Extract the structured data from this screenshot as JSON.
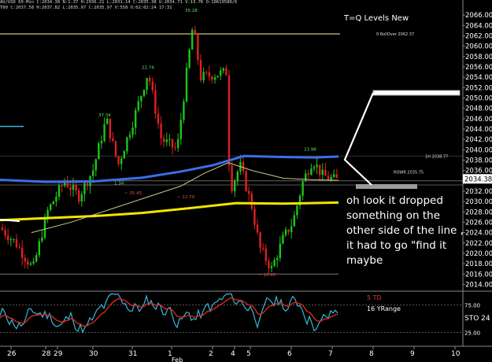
{
  "header": {
    "line1": "AU/USD 60-Min C:2034.38 N:1.37 H:2036.21 L:2031.14 C:2035.38 U:2034.71 V:13.7K O:10619580/6",
    "line2": "T00 C:2037.58 H:2037.82 L:2035.97 C:2035.97 V:558 O:02:02:24 17:31"
  },
  "panel_title": "T=Q Levels New",
  "annotation_note": "oh look it dropped something on the other side of the line , it had to go \"find it maybe",
  "colors": {
    "background": "#000000",
    "candle_up": "#19c719",
    "candle_down": "#e02020",
    "ma_blue": "#3b6fe8",
    "ma_yellow": "#f2e500",
    "ma_thin": "#c9c98a",
    "osc_cyan": "#35b8d6",
    "osc_red": "#d8281c",
    "rollover": "#e8d890"
  },
  "chart_data": {
    "type": "candlestick",
    "title": "T=Q Levels New",
    "y_range": [
      2013,
      2068
    ],
    "y_ticks": [
      "2066.00",
      "2064.00",
      "2062.00",
      "2060.00",
      "2058.00",
      "2056.00",
      "2054.00",
      "2052.00",
      "2050.00",
      "2048.00",
      "2046.00",
      "2044.00",
      "2042.00",
      "2040.00",
      "2038.00",
      "2036.00",
      "2034.00",
      "2032.00",
      "2030.00",
      "2028.00",
      "2026.00",
      "2024.00",
      "2022.00",
      "2020.00",
      "2018.00",
      "2016.00",
      "2014.00"
    ],
    "last_price": "2034.38",
    "x_labels": [
      "26",
      "28",
      "29",
      "30",
      "31",
      "1",
      "2",
      "4",
      "5",
      "6",
      "7",
      "8",
      "9",
      "10"
    ],
    "month_label": "Feb",
    "levels": [
      {
        "label": "0 RollOver 2062.37",
        "value": 2062.37
      },
      {
        "label": "1H 2038.77",
        "value": 2038.77
      },
      {
        "label": "ROWR 2035.75",
        "value": 2035.75
      }
    ],
    "peak_labels": [
      {
        "text": "35.28",
        "value": 2066.6
      },
      {
        "text": "22.74",
        "value": 2055.6
      },
      {
        "text": "37.34",
        "value": 2046.4
      },
      {
        "text": "23.98",
        "value": 2039.8
      },
      {
        "text": "~ 35.45",
        "value": 2031.4
      },
      {
        "text": "~ 12.79",
        "value": 2030.6
      },
      {
        "text": "~ 10.45",
        "value": 2015.6
      },
      {
        "text": "1.34",
        "value": 2033.3
      }
    ],
    "oscillator": {
      "labels": [
        "5 TD",
        "16 YRange"
      ],
      "y_ticks": [
        "75.00",
        "25.00"
      ],
      "side_label": "STO 24"
    }
  }
}
